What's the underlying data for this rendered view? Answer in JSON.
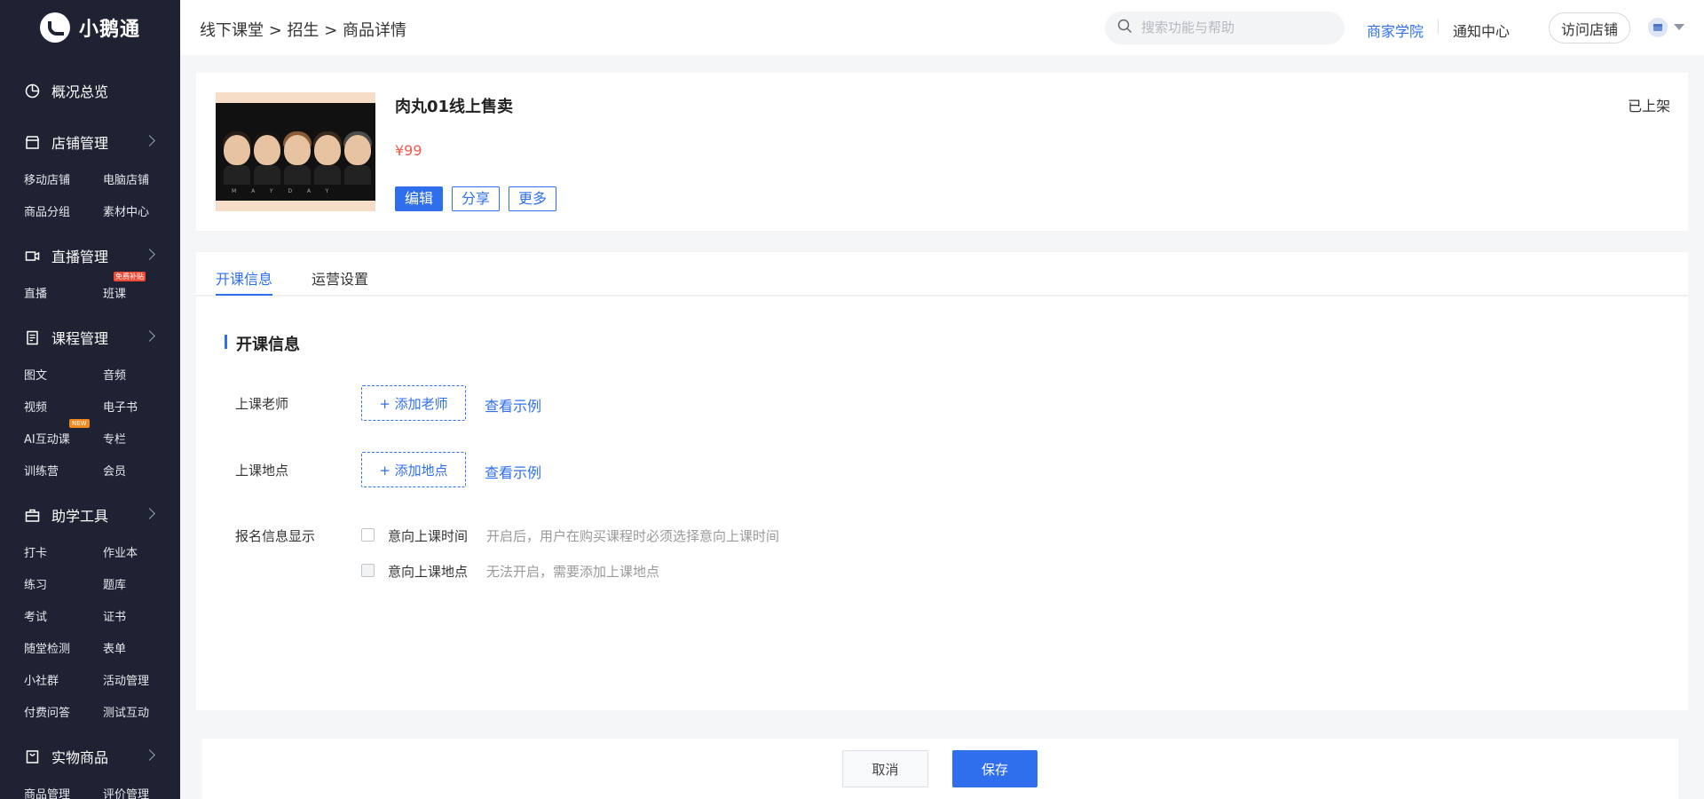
{
  "brand": {
    "name": "小鹅通"
  },
  "colors": {
    "accent": "#2f6fed",
    "sidebar_bg": "#1e2233",
    "price": "#f25a4a"
  },
  "sidebar": {
    "overview": "概况总览",
    "store": {
      "label": "店铺管理",
      "items": [
        "移动店铺",
        "电脑店铺",
        "商品分组",
        "素材中心"
      ]
    },
    "live": {
      "label": "直播管理",
      "items": [
        "直播",
        "班课"
      ],
      "badge": "免费补贴"
    },
    "course": {
      "label": "课程管理",
      "items": [
        "图文",
        "音频",
        "视频",
        "电子书",
        "AI互动课",
        "专栏",
        "训练营",
        "会员"
      ],
      "badge": "NEW"
    },
    "tools": {
      "label": "助学工具",
      "items": [
        "打卡",
        "作业本",
        "练习",
        "题库",
        "考试",
        "证书",
        "随堂检测",
        "表单",
        "小社群",
        "活动管理",
        "付费问答",
        "测试互动"
      ]
    },
    "goods": {
      "label": "实物商品",
      "items": [
        "商品管理",
        "评价管理"
      ]
    }
  },
  "header": {
    "breadcrumb": "线下课堂 > 招生 > 商品详情",
    "search_placeholder": "搜索功能与帮助",
    "links": [
      "商家学院",
      "通知中心"
    ],
    "visit_store": "访问店铺"
  },
  "product": {
    "title": "肉丸01线上售卖",
    "price": "¥99",
    "status": "已上架",
    "thumb_caption": "MAYDAY",
    "buttons": {
      "edit": "编辑",
      "share": "分享",
      "more": "更多"
    }
  },
  "tabs": [
    {
      "label": "开课信息"
    },
    {
      "label": "运营设置"
    }
  ],
  "form": {
    "section_title": "开课信息",
    "teacher_label": "上课老师",
    "teacher_button": "+ 添加老师",
    "location_label": "上课地点",
    "location_button": "+ 添加地点",
    "example_link": "查看示例",
    "signup_label": "报名信息显示",
    "options": [
      {
        "label": "意向上课时间",
        "hint": "开启后，用户在购买课程时必须选择意向上课时间"
      },
      {
        "label": "意向上课地点",
        "hint": "无法开启，需要添加上课地点"
      }
    ]
  },
  "footer": {
    "cancel": "取消",
    "save": "保存"
  }
}
